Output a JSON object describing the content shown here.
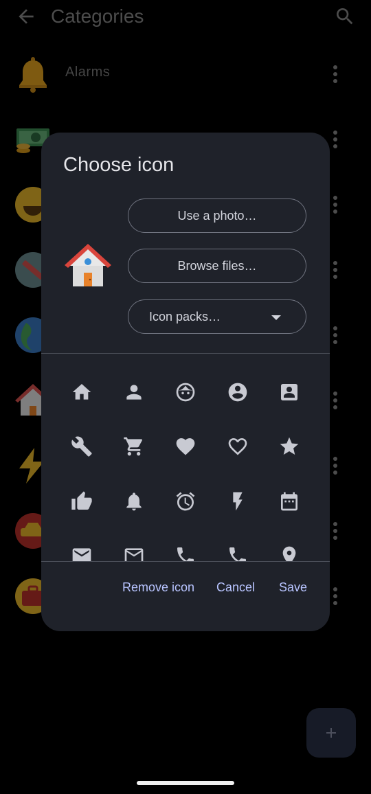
{
  "app_bar": {
    "title": "Categories",
    "back_icon": "arrow-left-icon",
    "search_icon": "search-icon"
  },
  "categories": [
    {
      "label": "Alarms",
      "icon": "bell-icon"
    },
    {
      "label": "",
      "icon": "money-icon"
    },
    {
      "label": "",
      "icon": "grinning-face-icon"
    },
    {
      "label": "",
      "icon": "tools-icon"
    },
    {
      "label": "",
      "icon": "globe-icon"
    },
    {
      "label": "",
      "icon": "house-icon"
    },
    {
      "label": "",
      "icon": "lightning-icon"
    },
    {
      "label": "",
      "icon": "car-icon"
    },
    {
      "label": "",
      "icon": "briefcase-icon"
    }
  ],
  "dialog": {
    "title": "Choose icon",
    "preview_icon": "house-icon",
    "use_photo_label": "Use a photo…",
    "browse_files_label": "Browse files…",
    "icon_packs_label": "Icon packs…",
    "icon_grid": [
      [
        "home-icon",
        "person-icon",
        "face-icon",
        "account-circle-icon",
        "contact-card-icon"
      ],
      [
        "wrench-icon",
        "cart-icon",
        "heart-icon",
        "heart-outline-icon",
        "star-icon"
      ],
      [
        "thumb-up-icon",
        "bell-icon",
        "alarm-clock-icon",
        "flash-icon",
        "calendar-icon"
      ],
      [
        "mail-icon",
        "mail-outline-icon",
        "phone-icon",
        "phone-outline-icon",
        "location-pin-icon"
      ]
    ],
    "remove_label": "Remove icon",
    "cancel_label": "Cancel",
    "save_label": "Save"
  },
  "colors": {
    "dialog_bg": "#1f222a",
    "accent_text": "#b8c4ff",
    "icon_gray": "#c8cad2",
    "fab_bg": "#2a3247"
  }
}
